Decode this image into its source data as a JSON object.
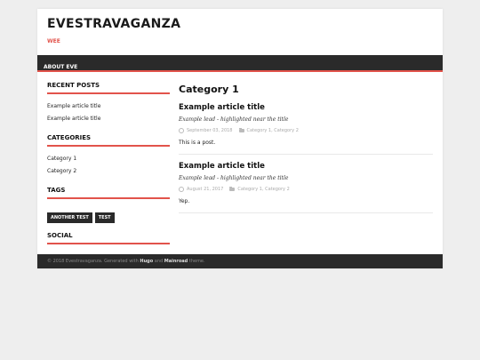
{
  "site": {
    "title": "EVESTRAVAGANZA",
    "tagline": "WEE"
  },
  "nav": {
    "items": [
      {
        "label": "ABOUT EVE"
      }
    ]
  },
  "sidebar": {
    "recent_posts": {
      "title": "RECENT POSTS",
      "items": [
        "Example article title",
        "Example article title"
      ]
    },
    "categories": {
      "title": "CATEGORIES",
      "items": [
        "Category 1",
        "Category 2"
      ]
    },
    "tags": {
      "title": "TAGS",
      "items": [
        "ANOTHER TEST",
        "TEST"
      ]
    },
    "social": {
      "title": "SOCIAL"
    }
  },
  "main": {
    "heading": "Category 1",
    "articles": [
      {
        "title": "Example article title",
        "lead": "Example lead - highlighted near the title",
        "date": "September 03, 2018",
        "categories": "Category 1, Category 2",
        "body": "This is a post."
      },
      {
        "title": "Example article title",
        "lead": "Example lead - highlighted near the title",
        "date": "August 21, 2017",
        "categories": "Category 1, Category 2",
        "body": "Yep."
      }
    ]
  },
  "footer": {
    "prefix": "© 2018 Evestravaganza. Generated with",
    "hugo": "Hugo",
    "and": "and",
    "theme_name": "Mainroad",
    "suffix": "theme."
  },
  "colors": {
    "accent": "#e2534b",
    "dark": "#2a2a2a",
    "background": "#eeeeee"
  }
}
